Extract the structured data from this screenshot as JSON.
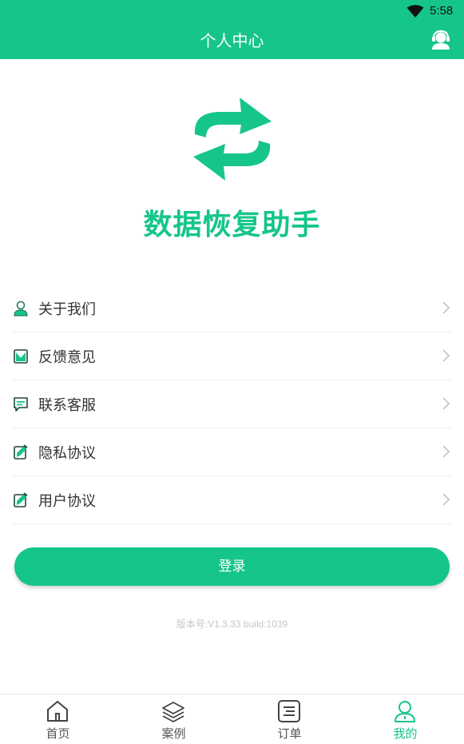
{
  "status_bar": {
    "time": "5:58",
    "wifi_icon": "wifi-icon"
  },
  "header": {
    "title": "个人中心",
    "support_icon": "customer-service-icon"
  },
  "app": {
    "name": "数据恢复助手",
    "logo_icon": "sync-arrows-icon"
  },
  "menu": {
    "items": [
      {
        "label": "关于我们",
        "icon": "user-icon"
      },
      {
        "label": "反馈意见",
        "icon": "feedback-icon"
      },
      {
        "label": "联系客服",
        "icon": "chat-icon"
      },
      {
        "label": "隐私协议",
        "icon": "edit-document-icon"
      },
      {
        "label": "用户协议",
        "icon": "edit-document-icon"
      }
    ]
  },
  "login": {
    "label": "登录"
  },
  "version": {
    "text": "版本号:V1.3.33 build:1039"
  },
  "tabs": [
    {
      "label": "首页",
      "icon": "home-icon",
      "active": false
    },
    {
      "label": "案例",
      "icon": "layers-icon",
      "active": false
    },
    {
      "label": "订单",
      "icon": "list-icon",
      "active": false
    },
    {
      "label": "我的",
      "icon": "profile-icon",
      "active": true
    }
  ],
  "colors": {
    "accent": "#16c58b",
    "text": "#333333",
    "muted": "#c6c6c6"
  }
}
